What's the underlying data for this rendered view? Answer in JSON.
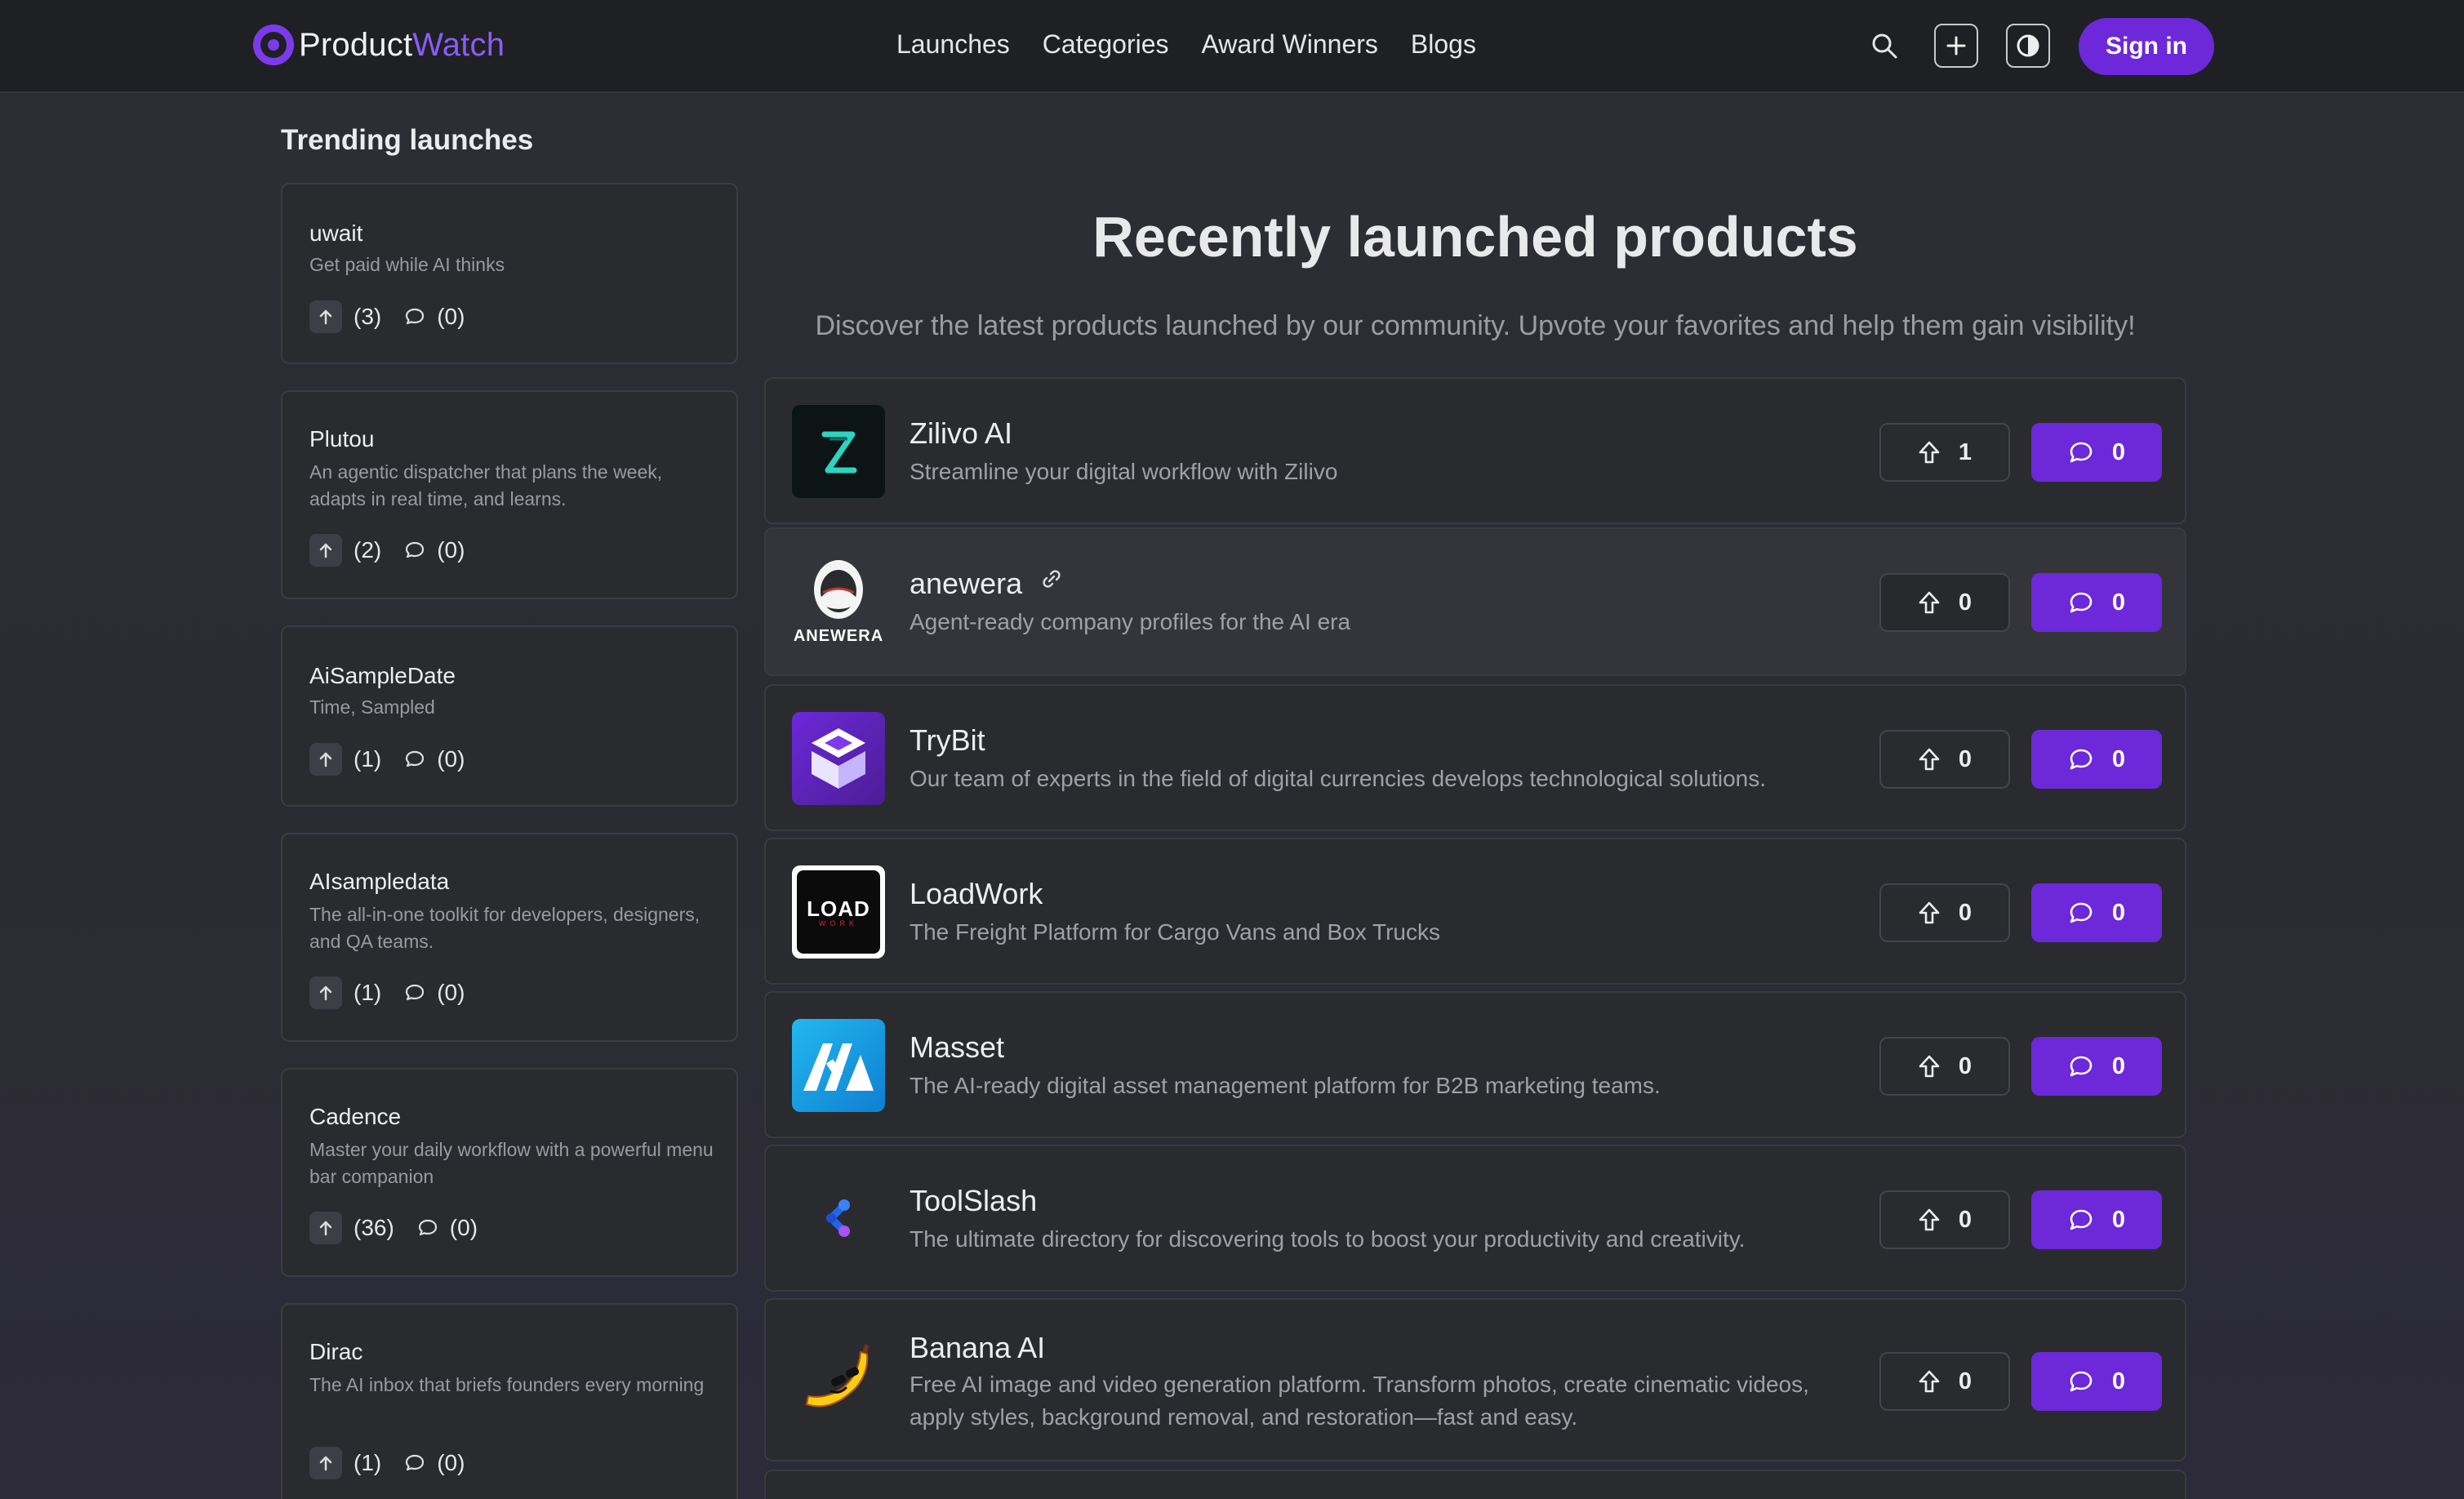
{
  "header": {
    "logo_product": "Product",
    "logo_watch": "Watch",
    "nav": [
      "Launches",
      "Categories",
      "Award Winners",
      "Blogs"
    ],
    "signin": "Sign in"
  },
  "trending": {
    "title": "Trending launches",
    "items": [
      {
        "name": "uwait",
        "desc": "Get paid while AI thinks",
        "votes": "(3)",
        "comments": "(0)"
      },
      {
        "name": "Plutou",
        "desc": "An agentic dispatcher that plans the week, adapts in real time, and learns.",
        "votes": "(2)",
        "comments": "(0)"
      },
      {
        "name": "AiSampleDate",
        "desc": "Time, Sampled",
        "votes": "(1)",
        "comments": "(0)"
      },
      {
        "name": "AIsampledata",
        "desc": "The all-in-one toolkit for developers, designers, and QA teams.",
        "votes": "(1)",
        "comments": "(0)"
      },
      {
        "name": "Cadence",
        "desc": "Master your daily workflow with a powerful menu bar companion",
        "votes": "(36)",
        "comments": "(0)"
      },
      {
        "name": "Dirac",
        "desc": "The AI inbox that briefs founders every morning",
        "votes": "(1)",
        "comments": "(0)"
      }
    ]
  },
  "main": {
    "title": "Recently launched products",
    "subtitle": "Discover the latest products launched by our community. Upvote your favorites and help them gain visibility!",
    "products": [
      {
        "name": "Zilivo AI",
        "desc": "Streamline your digital workflow with Zilivo",
        "upvotes": "1",
        "comments": "0",
        "logo": "zilivo-logo"
      },
      {
        "name": "anewera",
        "desc": "Agent-ready company profiles for the AI era",
        "upvotes": "0",
        "comments": "0",
        "logo": "anewera-logo",
        "logo_text": "ANEWERA"
      },
      {
        "name": "TryBit",
        "desc": "Our team of experts in the field of digital currencies develops technological solutions.",
        "upvotes": "0",
        "comments": "0",
        "logo": "trybit-logo"
      },
      {
        "name": "LoadWork",
        "desc": "The Freight Platform for Cargo Vans and Box Trucks",
        "upvotes": "0",
        "comments": "0",
        "logo": "loadwork-logo",
        "logo_text": "LOAD",
        "logo_subtext": "WORK"
      },
      {
        "name": "Masset",
        "desc": "The AI-ready digital asset management platform for B2B marketing teams.",
        "upvotes": "0",
        "comments": "0",
        "logo": "masset-logo"
      },
      {
        "name": "ToolSlash",
        "desc": "The ultimate directory for discovering tools to boost your productivity and creativity.",
        "upvotes": "0",
        "comments": "0",
        "logo": "toolslash-logo"
      },
      {
        "name": "Banana AI",
        "desc": "Free AI image and video generation platform. Transform photos, create cinematic videos, apply styles, background removal, and restoration—fast and easy.",
        "upvotes": "0",
        "comments": "0",
        "logo": "banana-logo"
      }
    ]
  },
  "colors": {
    "accent": "#6d28d9",
    "brand_watch": "#8b5cf6",
    "background": "#2b2d33",
    "card": "#2a2b2f"
  }
}
